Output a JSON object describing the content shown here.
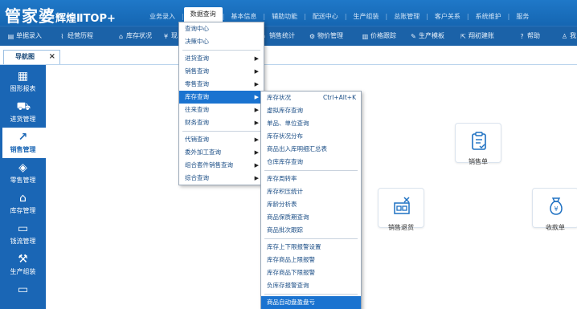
{
  "app": {
    "logo": "管家婆",
    "logo_sub": "辉煌ⅡTOP+"
  },
  "topnav": [
    {
      "label": "业务录入"
    },
    {
      "label": "数据查询",
      "active": true
    },
    {
      "label": "基本信息"
    },
    {
      "label": "辅助功能"
    },
    {
      "label": "配送中心"
    },
    {
      "label": "生产组装"
    },
    {
      "label": "总账管理"
    },
    {
      "label": "客户关系"
    },
    {
      "label": "系统维护"
    },
    {
      "label": "服务"
    }
  ],
  "toolbar": [
    {
      "label": "单据录入",
      "icon": "document-icon"
    },
    {
      "label": "经营历程",
      "icon": "chart-line-icon"
    },
    {
      "label": "库存状况",
      "icon": "warehouse-icon"
    },
    {
      "label": "现",
      "icon": "yen-icon"
    },
    {
      "label": "销售统计",
      "icon": "magnifier-icon"
    },
    {
      "label": "物价管理",
      "icon": "gear-icon"
    },
    {
      "label": "价格跟踪",
      "icon": "bar-chart-icon"
    },
    {
      "label": "生产模板",
      "icon": "wrench-icon"
    },
    {
      "label": "翔初建账",
      "icon": "external-link-icon"
    },
    {
      "label": "帮助",
      "icon": "question-icon"
    },
    {
      "label": "我",
      "icon": "user-icon"
    }
  ],
  "tab": {
    "label": "导航图",
    "close": "×"
  },
  "sidebar": [
    {
      "label": "图形报表",
      "icon": "grid-icon"
    },
    {
      "label": "进货管理",
      "icon": "cart-icon"
    },
    {
      "label": "销售管理",
      "icon": "trend-icon",
      "active": true
    },
    {
      "label": "零售管理",
      "icon": "tag-icon"
    },
    {
      "label": "库存管理",
      "icon": "house-icon"
    },
    {
      "label": "钱流管理",
      "icon": "money-icon"
    },
    {
      "label": "生产组装",
      "icon": "tools-icon"
    },
    {
      "label": "",
      "icon": "monitor-icon"
    }
  ],
  "cards": [
    {
      "label": "销售单",
      "icon": "clipboard-icon"
    },
    {
      "label": "销售退货",
      "icon": "return-icon"
    },
    {
      "label": "收款单",
      "icon": "money-bag-icon"
    }
  ],
  "menu_main": [
    {
      "label": "查询中心"
    },
    {
      "label": "决策中心"
    },
    {
      "sep": true
    },
    {
      "label": "进货查询",
      "arrow": true
    },
    {
      "label": "销售查询",
      "arrow": true
    },
    {
      "label": "零售查询",
      "arrow": true
    },
    {
      "label": "库存查询",
      "arrow": true,
      "selected": true
    },
    {
      "label": "往来查询",
      "arrow": true
    },
    {
      "label": "财务查询",
      "arrow": true
    },
    {
      "sep": true
    },
    {
      "label": "代销查询",
      "arrow": true
    },
    {
      "label": "委外加工查询",
      "arrow": true
    },
    {
      "label": "组合套件销售查询",
      "arrow": true
    },
    {
      "label": "综合查询",
      "arrow": true
    }
  ],
  "menu_sub": [
    {
      "label": "库存状况",
      "shortcut": "Ctrl+Alt+K"
    },
    {
      "label": "虚拟库存查询"
    },
    {
      "label": "单品、单位查询"
    },
    {
      "label": "库存状况分布"
    },
    {
      "label": "商品出入库明细汇总表"
    },
    {
      "label": "仓库库存查询"
    },
    {
      "sep": true
    },
    {
      "label": "库存周转率"
    },
    {
      "label": "库存积压统计"
    },
    {
      "label": "库龄分析表"
    },
    {
      "label": "商品保质期查询"
    },
    {
      "label": "商品批次跟踪"
    },
    {
      "sep": true
    },
    {
      "label": "库存上下限报警设置"
    },
    {
      "label": "库存商品上限报警"
    },
    {
      "label": "库存商品下限报警"
    },
    {
      "label": "负库存报警查询"
    },
    {
      "sep": true
    },
    {
      "label": "商品自动盘盈盘亏",
      "selected": true
    }
  ],
  "colors": {
    "header": "#1f78c8",
    "toolbar": "#1b62a8",
    "sidebar": "#1a66b5",
    "highlight": "#1a73d0"
  }
}
